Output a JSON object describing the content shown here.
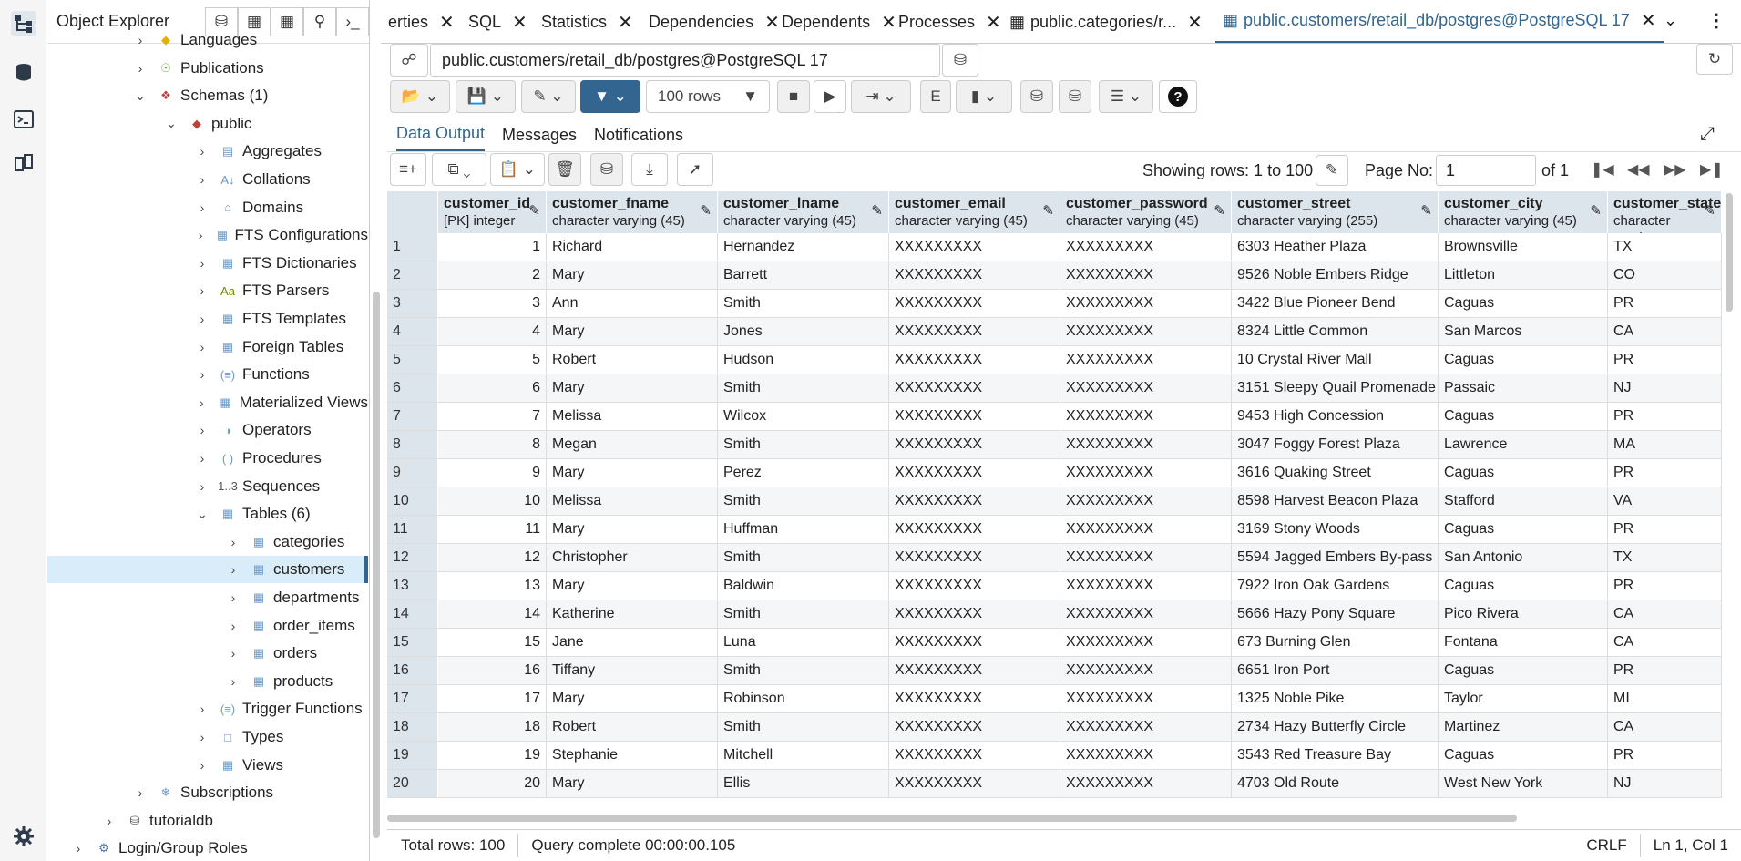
{
  "object_explorer": {
    "title": "Object Explorer",
    "tree": [
      {
        "label": "Languages",
        "icon": "languages-icon",
        "level": 2,
        "chev": ">"
      },
      {
        "label": "Publications",
        "icon": "publications-icon",
        "level": 2,
        "chev": ">"
      },
      {
        "label": "Schemas (1)",
        "icon": "schemas-icon",
        "level": 2,
        "chev": "v"
      },
      {
        "label": "public",
        "icon": "schema-icon",
        "level": 3,
        "chev": "v"
      },
      {
        "label": "Aggregates",
        "icon": "aggregates-icon",
        "level": 4,
        "chev": ">"
      },
      {
        "label": "Collations",
        "icon": "collations-icon",
        "level": 4,
        "chev": ">"
      },
      {
        "label": "Domains",
        "icon": "domains-icon",
        "level": 4,
        "chev": ">"
      },
      {
        "label": "FTS Configurations",
        "icon": "fts-config-icon",
        "level": 4,
        "chev": ">"
      },
      {
        "label": "FTS Dictionaries",
        "icon": "fts-dict-icon",
        "level": 4,
        "chev": ">"
      },
      {
        "label": "FTS Parsers",
        "icon": "fts-parser-icon",
        "level": 4,
        "chev": ">"
      },
      {
        "label": "FTS Templates",
        "icon": "fts-template-icon",
        "level": 4,
        "chev": ">"
      },
      {
        "label": "Foreign Tables",
        "icon": "foreign-table-icon",
        "level": 4,
        "chev": ">"
      },
      {
        "label": "Functions",
        "icon": "functions-icon",
        "level": 4,
        "chev": ">"
      },
      {
        "label": "Materialized Views",
        "icon": "mview-icon",
        "level": 4,
        "chev": ">"
      },
      {
        "label": "Operators",
        "icon": "operators-icon",
        "level": 4,
        "chev": ">"
      },
      {
        "label": "Procedures",
        "icon": "procedures-icon",
        "level": 4,
        "chev": ">"
      },
      {
        "label": "Sequences",
        "icon": "sequences-icon",
        "level": 4,
        "chev": ">"
      },
      {
        "label": "Tables (6)",
        "icon": "tables-icon",
        "level": 4,
        "chev": "v"
      },
      {
        "label": "categories",
        "icon": "table-icon",
        "level": 5,
        "chev": ">"
      },
      {
        "label": "customers",
        "icon": "table-icon",
        "level": 5,
        "chev": ">",
        "selected": true
      },
      {
        "label": "departments",
        "icon": "table-icon",
        "level": 5,
        "chev": ">"
      },
      {
        "label": "order_items",
        "icon": "table-icon",
        "level": 5,
        "chev": ">"
      },
      {
        "label": "orders",
        "icon": "table-icon",
        "level": 5,
        "chev": ">"
      },
      {
        "label": "products",
        "icon": "table-icon",
        "level": 5,
        "chev": ">"
      },
      {
        "label": "Trigger Functions",
        "icon": "trigger-functions-icon",
        "level": 4,
        "chev": ">"
      },
      {
        "label": "Types",
        "icon": "types-icon",
        "level": 4,
        "chev": ">"
      },
      {
        "label": "Views",
        "icon": "views-icon",
        "level": 4,
        "chev": ">"
      },
      {
        "label": "Subscriptions",
        "icon": "subscriptions-icon",
        "level": 2,
        "chev": ">"
      },
      {
        "label": "tutorialdb",
        "icon": "database-icon",
        "level": 1,
        "chev": ">"
      },
      {
        "label": "Login/Group Roles",
        "icon": "roles-icon",
        "level": 0,
        "chev": ">"
      }
    ]
  },
  "tabs": [
    {
      "label": "erties"
    },
    {
      "label": "SQL"
    },
    {
      "label": "Statistics"
    },
    {
      "label": "Dependencies"
    },
    {
      "label": "Dependents"
    },
    {
      "label": "Processes"
    },
    {
      "label": "public.categories/r..."
    },
    {
      "label": "public.customers/retail_db/postgres@PostgreSQL 17",
      "active": true
    }
  ],
  "connection": "public.customers/retail_db/postgres@PostgreSQL 17",
  "toolbar": {
    "rows_limit": "100 rows"
  },
  "result_tabs": [
    "Data Output",
    "Messages",
    "Notifications"
  ],
  "pager": {
    "showing": "Showing rows: 1 to 100",
    "page_label": "Page No:",
    "page": "1",
    "of": "of 1"
  },
  "columns": [
    {
      "name": "customer_id",
      "type": "[PK] integer"
    },
    {
      "name": "customer_fname",
      "type": "character varying (45)"
    },
    {
      "name": "customer_lname",
      "type": "character varying (45)"
    },
    {
      "name": "customer_email",
      "type": "character varying (45)"
    },
    {
      "name": "customer_password",
      "type": "character varying (45)"
    },
    {
      "name": "customer_street",
      "type": "character varying (255)"
    },
    {
      "name": "customer_city",
      "type": "character varying (45)"
    },
    {
      "name": "customer_state",
      "type": "character varying"
    }
  ],
  "rows": [
    [
      1,
      "Richard",
      "Hernandez",
      "XXXXXXXXX",
      "XXXXXXXXX",
      "6303 Heather Plaza",
      "Brownsville",
      "TX"
    ],
    [
      2,
      "Mary",
      "Barrett",
      "XXXXXXXXX",
      "XXXXXXXXX",
      "9526 Noble Embers Ridge",
      "Littleton",
      "CO"
    ],
    [
      3,
      "Ann",
      "Smith",
      "XXXXXXXXX",
      "XXXXXXXXX",
      "3422 Blue Pioneer Bend",
      "Caguas",
      "PR"
    ],
    [
      4,
      "Mary",
      "Jones",
      "XXXXXXXXX",
      "XXXXXXXXX",
      "8324 Little Common",
      "San Marcos",
      "CA"
    ],
    [
      5,
      "Robert",
      "Hudson",
      "XXXXXXXXX",
      "XXXXXXXXX",
      "10 Crystal River Mall",
      "Caguas",
      "PR"
    ],
    [
      6,
      "Mary",
      "Smith",
      "XXXXXXXXX",
      "XXXXXXXXX",
      "3151 Sleepy Quail Promenade",
      "Passaic",
      "NJ"
    ],
    [
      7,
      "Melissa",
      "Wilcox",
      "XXXXXXXXX",
      "XXXXXXXXX",
      "9453 High Concession",
      "Caguas",
      "PR"
    ],
    [
      8,
      "Megan",
      "Smith",
      "XXXXXXXXX",
      "XXXXXXXXX",
      "3047 Foggy Forest Plaza",
      "Lawrence",
      "MA"
    ],
    [
      9,
      "Mary",
      "Perez",
      "XXXXXXXXX",
      "XXXXXXXXX",
      "3616 Quaking Street",
      "Caguas",
      "PR"
    ],
    [
      10,
      "Melissa",
      "Smith",
      "XXXXXXXXX",
      "XXXXXXXXX",
      "8598 Harvest Beacon Plaza",
      "Stafford",
      "VA"
    ],
    [
      11,
      "Mary",
      "Huffman",
      "XXXXXXXXX",
      "XXXXXXXXX",
      "3169 Stony Woods",
      "Caguas",
      "PR"
    ],
    [
      12,
      "Christopher",
      "Smith",
      "XXXXXXXXX",
      "XXXXXXXXX",
      "5594 Jagged Embers By-pass",
      "San Antonio",
      "TX"
    ],
    [
      13,
      "Mary",
      "Baldwin",
      "XXXXXXXXX",
      "XXXXXXXXX",
      "7922 Iron Oak Gardens",
      "Caguas",
      "PR"
    ],
    [
      14,
      "Katherine",
      "Smith",
      "XXXXXXXXX",
      "XXXXXXXXX",
      "5666 Hazy Pony Square",
      "Pico Rivera",
      "CA"
    ],
    [
      15,
      "Jane",
      "Luna",
      "XXXXXXXXX",
      "XXXXXXXXX",
      "673 Burning Glen",
      "Fontana",
      "CA"
    ],
    [
      16,
      "Tiffany",
      "Smith",
      "XXXXXXXXX",
      "XXXXXXXXX",
      "6651 Iron Port",
      "Caguas",
      "PR"
    ],
    [
      17,
      "Mary",
      "Robinson",
      "XXXXXXXXX",
      "XXXXXXXXX",
      "1325 Noble Pike",
      "Taylor",
      "MI"
    ],
    [
      18,
      "Robert",
      "Smith",
      "XXXXXXXXX",
      "XXXXXXXXX",
      "2734 Hazy Butterfly Circle",
      "Martinez",
      "CA"
    ],
    [
      19,
      "Stephanie",
      "Mitchell",
      "XXXXXXXXX",
      "XXXXXXXXX",
      "3543 Red Treasure Bay",
      "Caguas",
      "PR"
    ],
    [
      20,
      "Mary",
      "Ellis",
      "XXXXXXXXX",
      "XXXXXXXXX",
      "4703 Old Route",
      "West New York",
      "NJ"
    ]
  ],
  "status": {
    "total": "Total rows: 100",
    "query": "Query complete 00:00:00.105",
    "eol": "CRLF",
    "pos": "Ln 1, Col 1"
  },
  "colors": {
    "accent": "#326690",
    "header_bg": "#dce4ec",
    "selected_bg": "#d8ecfa"
  }
}
